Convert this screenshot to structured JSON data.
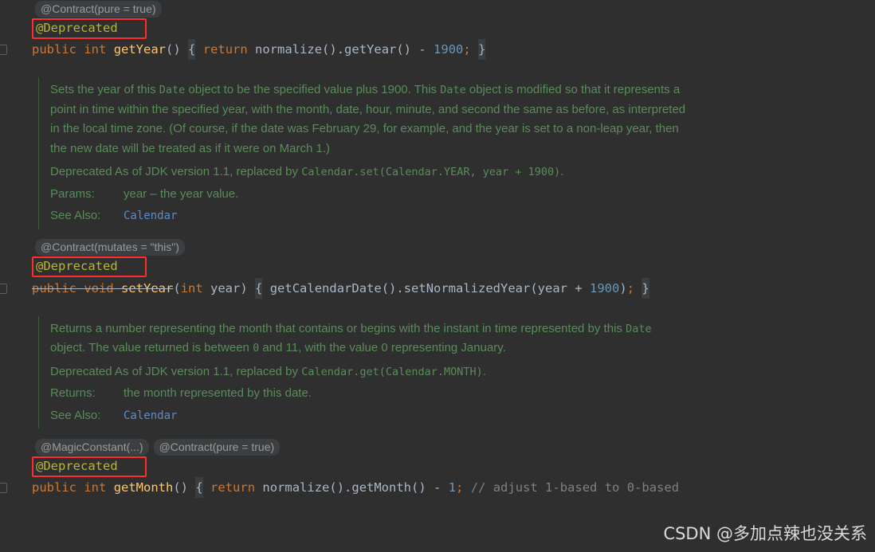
{
  "editor": {
    "theme_background": "#2f2f2f",
    "accent_highlight_color": "#ff2d2d",
    "deprecated_annotation_color": "#bbb529",
    "doc_text_color": "#5a8c5a",
    "link_color": "#5c8ccc",
    "keyword_color": "#cc7832",
    "method_color": "#ffc66d",
    "identifier_color": "#a9b7c6",
    "number_color": "#6897bb",
    "comment_color": "#808080",
    "hint_chip_color": "#9a9a9a"
  },
  "blocks": [
    {
      "hints": [
        "@Contract(pure = true)"
      ],
      "annotation": "@Deprecated",
      "signature": {
        "kw1": "public",
        "kw2": "int",
        "method": "getYear",
        "parens": "()",
        "brace_open": "{",
        "return_kw": "return",
        "body": " normalize().getYear() ",
        "op": "-",
        "number": "1900",
        "semi": ";",
        "brace_close": "}"
      }
    },
    {
      "hints": [
        "@Contract(mutates = \"this\")"
      ],
      "annotation": "@Deprecated",
      "signature": {
        "kw1": "public",
        "kw2": "void",
        "method": "setYear",
        "param_open": "(",
        "param_kw": "int",
        "param_name": " year",
        "param_close": ")",
        "brace_open": "{",
        "body": " getCalendarDate().setNormalizedYear(year ",
        "op": "+",
        "number": "1900",
        "tail": ")",
        "semi": ";",
        "brace_close": "}"
      }
    },
    {
      "hints": [
        "@MagicConstant(...)",
        "@Contract(pure = true)"
      ],
      "annotation": "@Deprecated",
      "signature": {
        "kw1": "public",
        "kw2": "int",
        "method": "getMonth",
        "parens": "()",
        "brace_open": "{",
        "return_kw": "return",
        "body": " normalize().getMonth() ",
        "op": "-",
        "number": "1",
        "semi": ";",
        "comment": "// adjust 1-based to 0-based"
      }
    }
  ],
  "docs": [
    {
      "paragraph_pre": "Sets the year of this ",
      "paragraph_code1": "Date",
      "paragraph_mid": " object to be the specified value plus 1900. This ",
      "paragraph_code2": "Date",
      "paragraph_post": " object is modified so that it represents a point in time within the specified year, with the month, date, hour, minute, and second the same as before, as interpreted in the local time zone. (Of course, if the date was February 29, for example, and the year is set to a non-leap year, then the new date will be treated as if it were on March 1.)",
      "deprecated_label": "Deprecated",
      "deprecated_text": " As of JDK version 1.1, replaced by ",
      "deprecated_code": "Calendar.set(Calendar.YEAR, year + 1900)",
      "deprecated_period": ".",
      "tag1_label": "Params:",
      "tag1_value": "year – the year value.",
      "tag2_label": "See Also:",
      "tag2_value": "Calendar"
    },
    {
      "paragraph_pre": "Returns a number representing the month that contains or begins with the instant in time represented by this ",
      "paragraph_code1": "Date",
      "paragraph_mid": " object. The value returned is between ",
      "paragraph_code2": "0",
      "paragraph_post": " and 11, with the value 0 representing January.",
      "deprecated_label": "Deprecated",
      "deprecated_text": " As of JDK version 1.1, replaced by ",
      "deprecated_code": "Calendar.get(Calendar.MONTH)",
      "deprecated_period": ".",
      "tag1_label": "Returns:",
      "tag1_value": "the month represented by this date.",
      "tag2_label": "See Also:",
      "tag2_value": "Calendar"
    }
  ],
  "watermark": {
    "text": "CSDN @多加点辣也没关系"
  }
}
